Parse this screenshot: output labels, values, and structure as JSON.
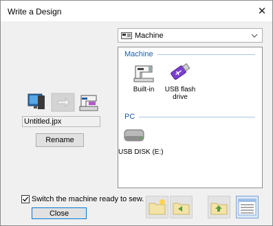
{
  "window": {
    "title": "Write a Design"
  },
  "target_dropdown": {
    "selected": "Machine"
  },
  "panel": {
    "groups": [
      {
        "label": "Machine"
      },
      {
        "label": "PC"
      }
    ],
    "devices": {
      "builtin": "Built-in",
      "usb_line1": "USB flash",
      "usb_line2": "drive",
      "usb_disk": "USB DISK (E:)"
    }
  },
  "filename": {
    "value": "Untitled.jpx"
  },
  "buttons": {
    "rename": "Rename",
    "close": "Close"
  },
  "checkbox": {
    "label": "Switch the machine ready to sew.",
    "checked": true
  },
  "colors": {
    "accent": "#1e5aa8",
    "usb_purple": "#7b3fd0",
    "close_border": "#0078d7"
  }
}
